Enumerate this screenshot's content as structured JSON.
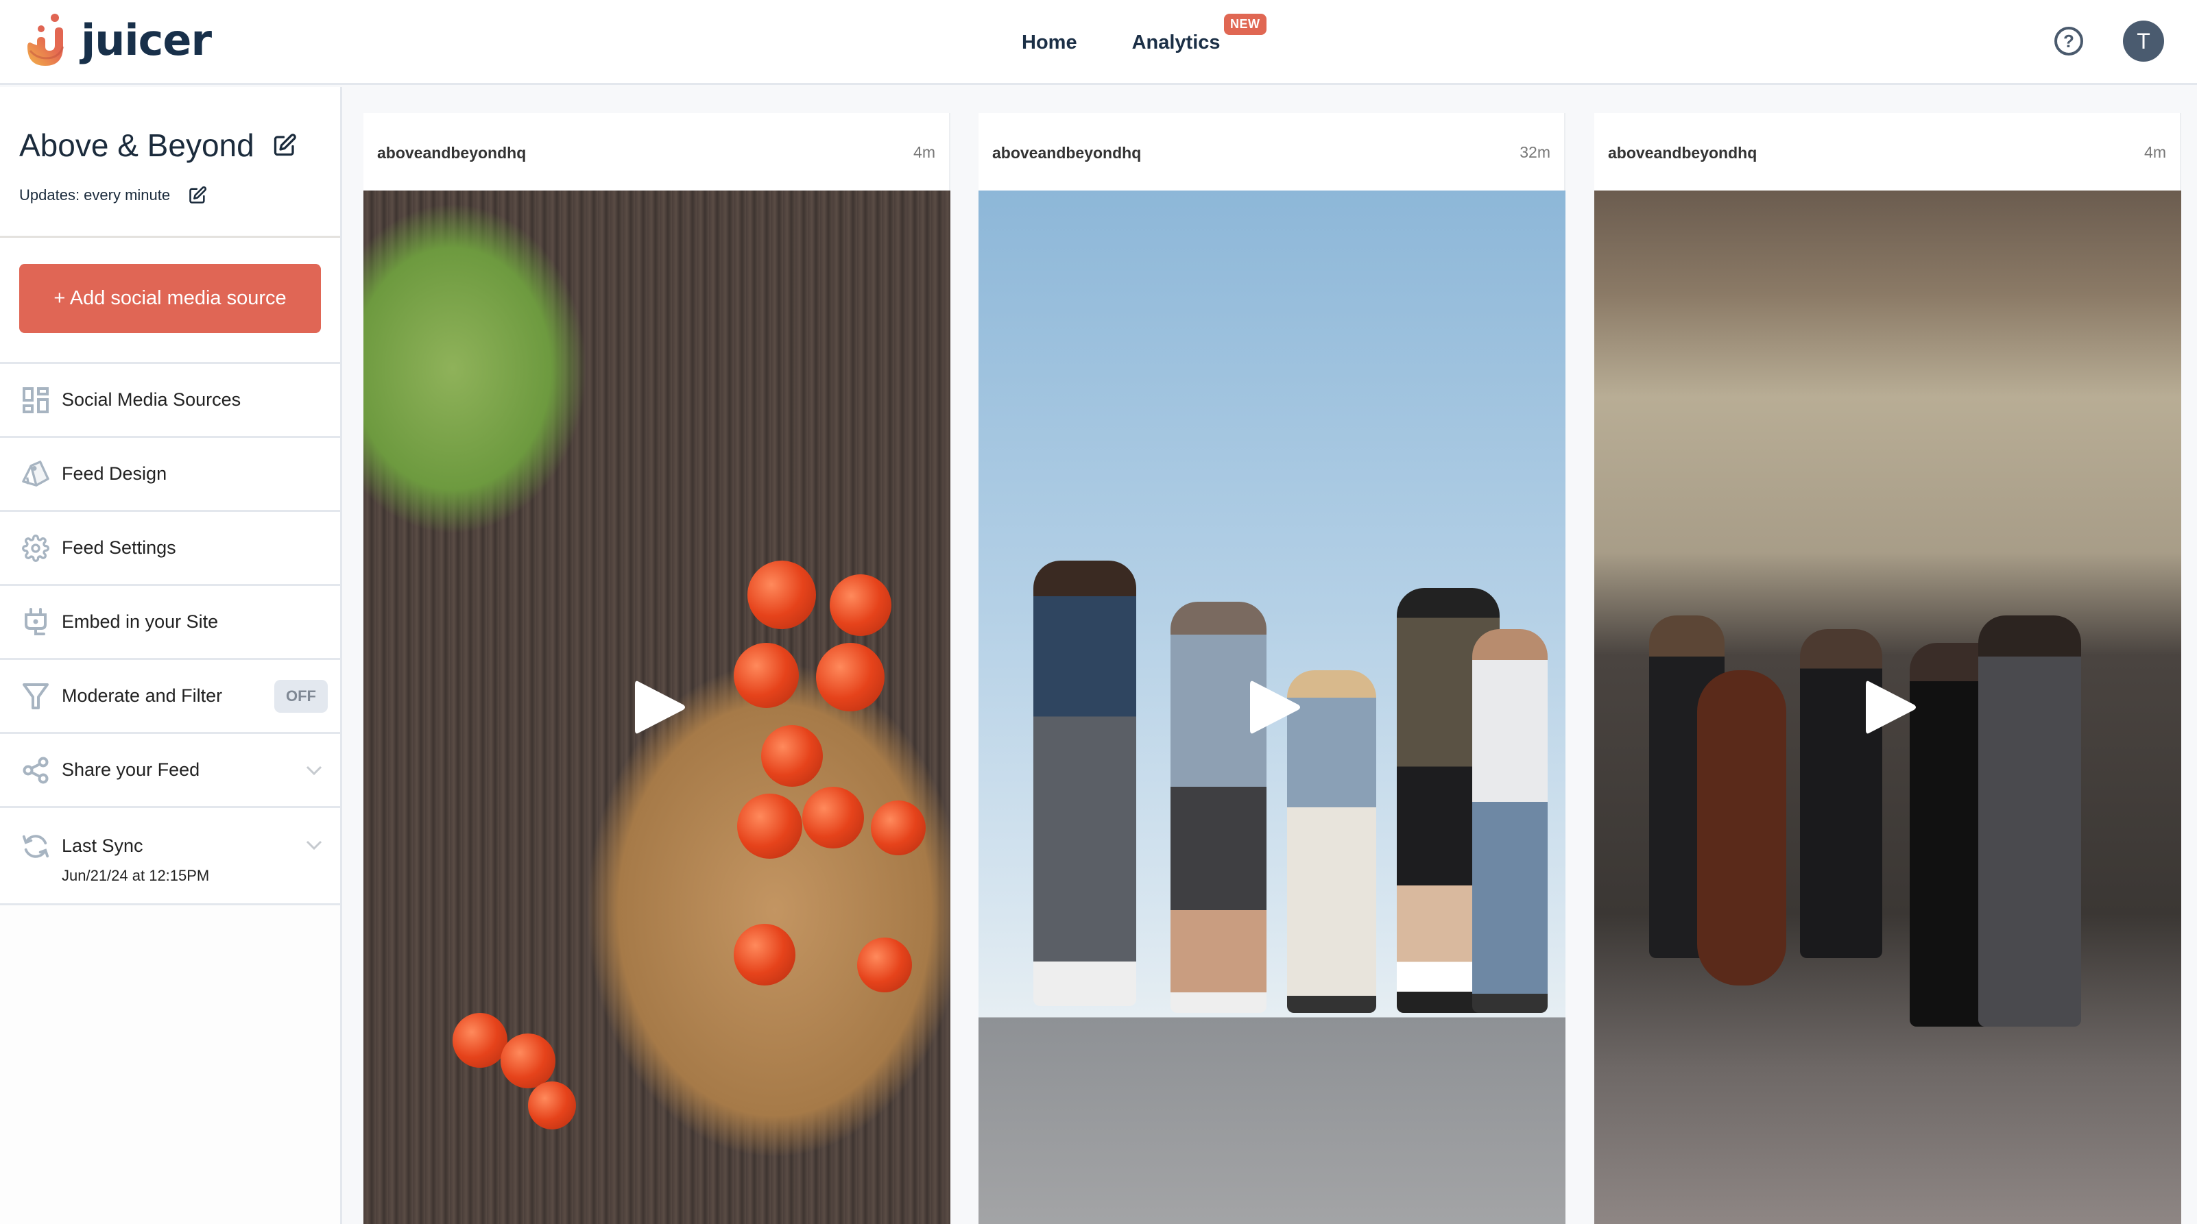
{
  "header": {
    "brand": "juicer",
    "nav": [
      {
        "label": "Home"
      },
      {
        "label": "Analytics",
        "badge": "NEW"
      }
    ],
    "help_icon": "question-circle-icon",
    "avatar_initial": "T"
  },
  "sidebar": {
    "feed_name": "Above & Beyond",
    "updates_label": "Updates: every minute",
    "add_source_label": "+ Add social media source",
    "items": [
      {
        "label": "Social Media Sources",
        "icon": "grid-icon"
      },
      {
        "label": "Feed Design",
        "icon": "swatch-icon"
      },
      {
        "label": "Feed Settings",
        "icon": "gear-icon"
      },
      {
        "label": "Embed in your Site",
        "icon": "plug-icon"
      },
      {
        "label": "Moderate and Filter",
        "icon": "filter-icon",
        "status": "OFF"
      },
      {
        "label": "Share your Feed",
        "icon": "share-icon"
      },
      {
        "label": "Last Sync",
        "icon": "sync-icon",
        "sub": "Jun/21/24 at 12:15PM"
      }
    ]
  },
  "posts": [
    {
      "user": "aboveandbeyondhq",
      "time": "4m",
      "media": "video"
    },
    {
      "user": "aboveandbeyondhq",
      "time": "32m",
      "media": "video"
    },
    {
      "user": "aboveandbeyondhq",
      "time": "4m",
      "media": "video"
    }
  ],
  "colors": {
    "accent": "#e06655",
    "navy": "#18304a",
    "icon_gray": "#a7b4c1"
  }
}
